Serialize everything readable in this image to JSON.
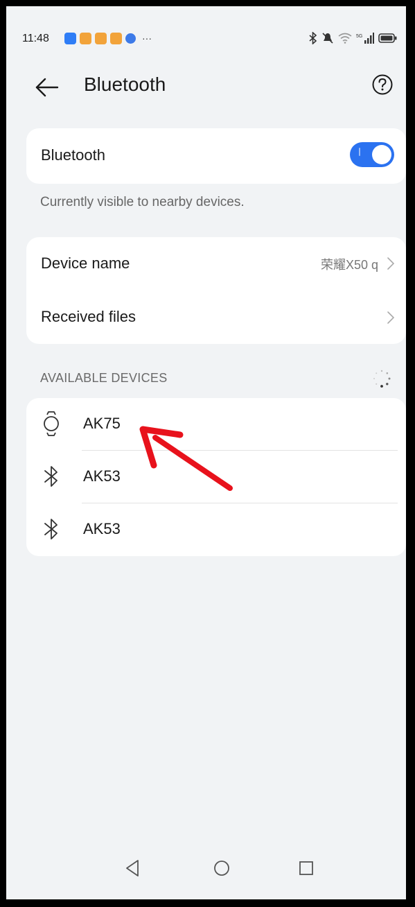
{
  "status_bar": {
    "time": "11:48",
    "more": "···",
    "signal_label": "5G"
  },
  "header": {
    "title": "Bluetooth",
    "back_icon": "arrow-left-icon",
    "help_icon": "help-circle-icon"
  },
  "bluetooth_card": {
    "label": "Bluetooth",
    "enabled": true
  },
  "visibility_note": "Currently visible to nearby devices.",
  "device_card": {
    "device_name_label": "Device name",
    "device_name_value": "荣耀X50 q",
    "received_files_label": "Received files"
  },
  "available": {
    "header": "AVAILABLE DEVICES",
    "devices": [
      {
        "name": "AK75",
        "icon": "watch-icon"
      },
      {
        "name": "AK53",
        "icon": "bluetooth-icon"
      },
      {
        "name": "AK53",
        "icon": "bluetooth-icon"
      }
    ]
  },
  "colors": {
    "accent": "#2b72f0",
    "annotation": "#e8121c",
    "background": "#f1f3f5"
  }
}
